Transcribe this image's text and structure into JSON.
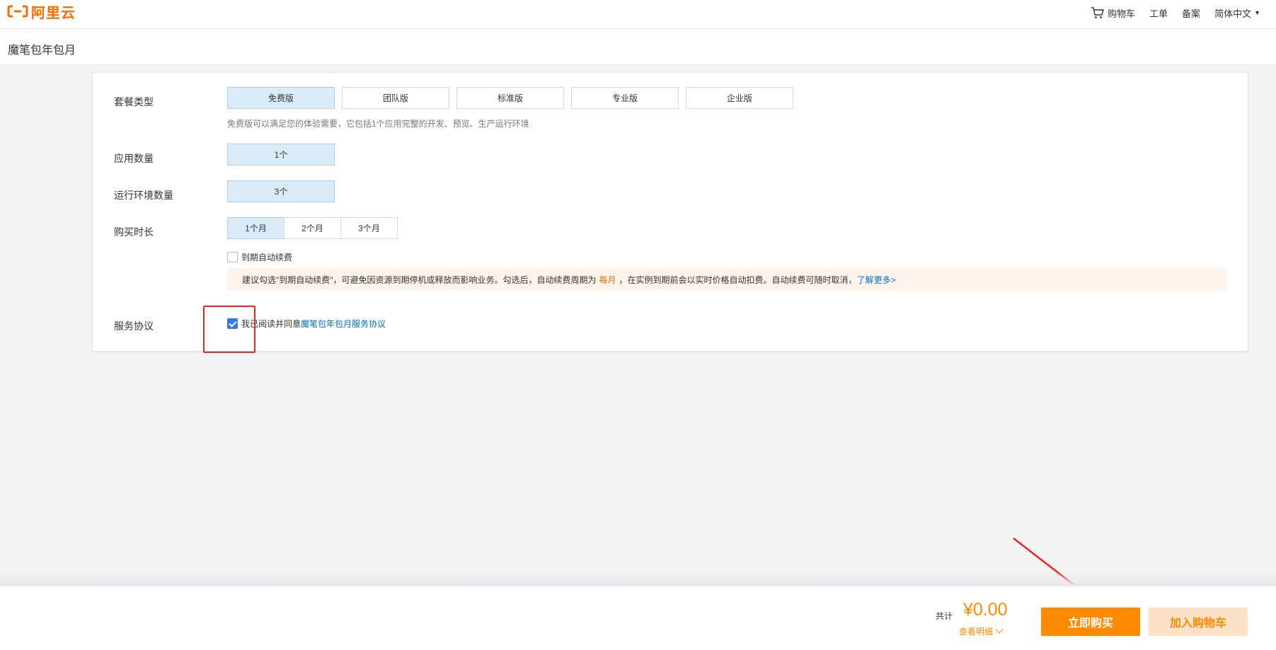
{
  "brand": {
    "name": "阿里云",
    "color": "#ff6a00"
  },
  "topnav": {
    "cart": "购物车",
    "ticket": "工单",
    "filing": "备案",
    "language": "简体中文"
  },
  "page": {
    "title": "魔笔包年包月"
  },
  "form": {
    "plan": {
      "label": "套餐类型",
      "options": [
        "免费版",
        "团队版",
        "标准版",
        "专业版",
        "企业版"
      ],
      "selected": "免费版",
      "hint": "免费版可以满足您的体验需要，它包括1个应用完整的开发、预览、生产运行环境"
    },
    "apps": {
      "label": "应用数量",
      "value": "1个"
    },
    "envs": {
      "label": "运行环境数量",
      "value": "3个"
    },
    "duration": {
      "label": "购买时长",
      "options": [
        "1个月",
        "2个月",
        "3个月"
      ],
      "selected": "1个月",
      "auto_renew_label": "到期自动续费",
      "auto_renew_checked": false,
      "notice_prefix": "建议勾选\"到期自动续费\"，可避免因资源到期停机或释放而影响业务。勾选后，自动续费周期为",
      "notice_period": "每月",
      "notice_suffix": "，在实例到期前会以实时价格自动扣费。自动续费可随时取消，",
      "notice_link": "了解更多>"
    },
    "agreement": {
      "label": "服务协议",
      "checked": true,
      "text": "我已阅读并同意",
      "link": "魔笔包年包月服务协议"
    }
  },
  "footer": {
    "total_label": "共计",
    "price": "¥0.00",
    "detail_link": "查看明细",
    "buy_button": "立即购买",
    "cart_button": "加入购物车"
  },
  "colors": {
    "accent": "#ff8a00",
    "link": "#0070cc",
    "selected_bg": "#d9ecf8",
    "annotation": "#f0231e"
  },
  "icons": [
    "aliyun-logo-icon",
    "cart-icon",
    "chevron-down-icon",
    "check-icon"
  ]
}
